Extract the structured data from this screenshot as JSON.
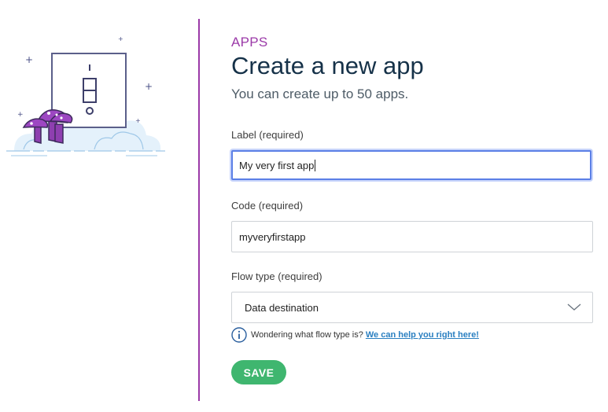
{
  "header": {
    "eyebrow": "APPS",
    "title": "Create a new app",
    "subtitle": "You can create up to 50 apps."
  },
  "form": {
    "label_field": {
      "label": "Label (required)",
      "value": "My very first app"
    },
    "code_field": {
      "label": "Code (required)",
      "value": "myveryfirstapp"
    },
    "flow_type": {
      "label": "Flow type (required)",
      "selected": "Data destination"
    },
    "help": {
      "text": "Wondering what flow type is?",
      "link": "We can help you right here!"
    },
    "save_label": "SAVE"
  },
  "icons": {
    "info": "info-circle-icon",
    "chevron": "chevron-down-icon",
    "illustration": "light-switch-mushroom-illustration"
  },
  "colors": {
    "accent": "#9b3aa8",
    "title": "#163249",
    "save": "#3fb66f",
    "link": "#2a7fc1",
    "focus": "#5b7fe6"
  }
}
